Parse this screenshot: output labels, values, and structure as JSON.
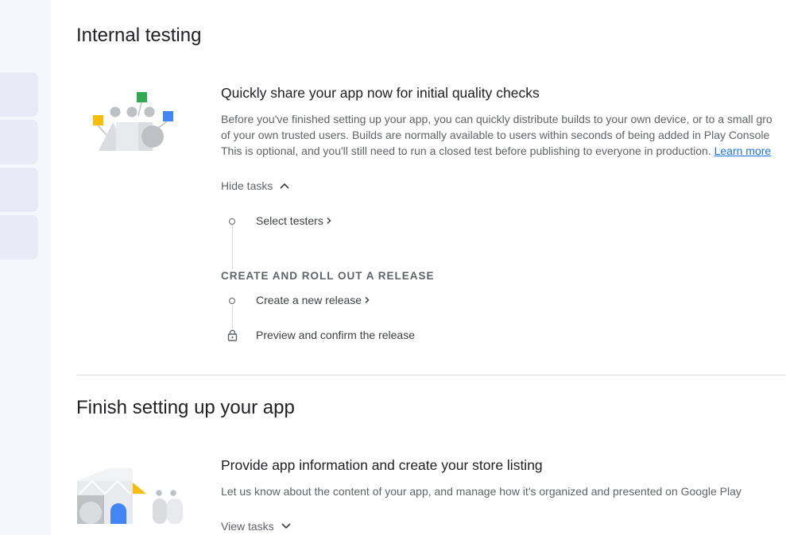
{
  "internal_testing": {
    "title": "Internal testing",
    "card_heading": "Quickly share your app now for initial quality checks",
    "description_lines": [
      "Before you've finished setting up your app, you can quickly distribute builds to your own device, or to a small gro",
      "of your own trusted users. Builds are normally available to users within seconds of being added in Play Console",
      "This is optional, and you'll still need to run a closed test before publishing to everyone in production. "
    ],
    "learn_more": "Learn more",
    "toggle_label": "Hide tasks",
    "steps": {
      "select_testers": "Select testers",
      "release_group_heading": "CREATE AND ROLL OUT A RELEASE",
      "create_release": "Create a new release",
      "preview_release": "Preview and confirm the release"
    }
  },
  "finish_setup": {
    "title": "Finish setting up your app",
    "card_heading": "Provide app information and create your store listing",
    "description": "Let us know about the content of your app, and manage how it's organized and presented on Google Play",
    "toggle_label": "View tasks"
  },
  "colors": {
    "link": "#1a73e8",
    "illus_green": "#34a853",
    "illus_yellow": "#fbbc04",
    "illus_blue": "#4285f4",
    "illus_grey": "#bdc1c6"
  }
}
